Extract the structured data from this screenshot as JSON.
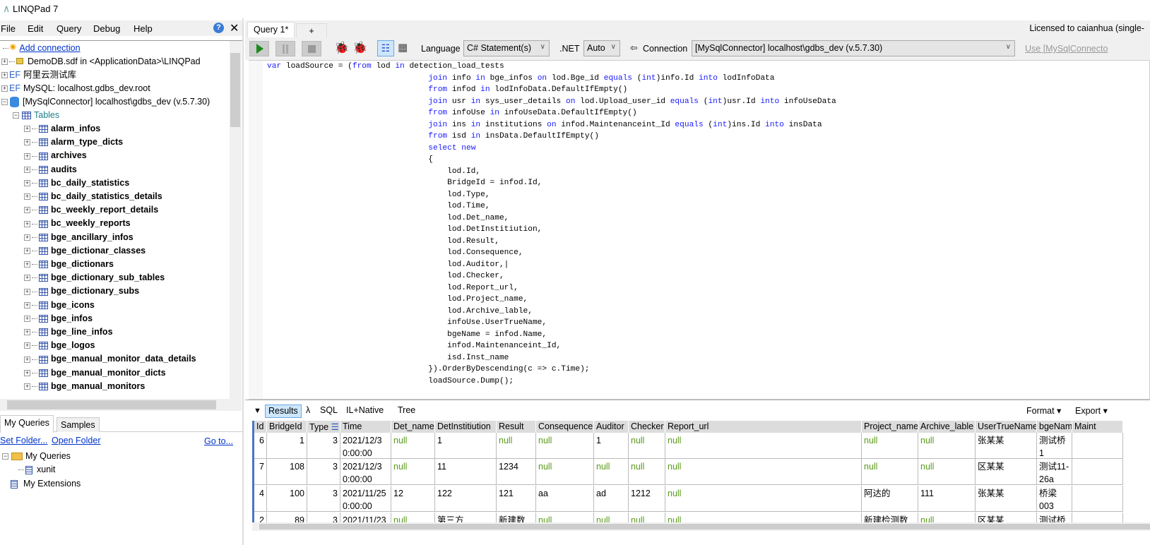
{
  "app": {
    "title": "LINQPad 7",
    "license": "Licensed to caianhua (single-"
  },
  "menu": [
    "File",
    "Edit",
    "Query",
    "Debug",
    "Help"
  ],
  "tree": {
    "add_connection": "Add connection",
    "connections": [
      {
        "icon": "database-file-icon",
        "label": "DemoDB.sdf in <ApplicationData>\\LINQPad"
      },
      {
        "icon": "ef-icon",
        "label": "阿里云测试库"
      },
      {
        "icon": "ef-icon",
        "label": "MySQL: localhost.gdbs_dev.root"
      },
      {
        "icon": "database-icon",
        "label": "[MySqlConnector] localhost\\gdbs_dev (v.5.7.30)"
      }
    ],
    "tables_label": "Tables",
    "tables": [
      "alarm_infos",
      "alarm_type_dicts",
      "archives",
      "audits",
      "bc_daily_statistics",
      "bc_daily_statistics_details",
      "bc_weekly_report_details",
      "bc_weekly_reports",
      "bge_ancillary_infos",
      "bge_dictionar_classes",
      "bge_dictionars",
      "bge_dictionary_sub_tables",
      "bge_dictionary_subs",
      "bge_icons",
      "bge_infos",
      "bge_line_infos",
      "bge_logos",
      "bge_manual_monitor_data_details",
      "bge_manual_monitor_dicts",
      "bge_manual_monitors"
    ]
  },
  "left_tabs": [
    "My Queries",
    "Samples"
  ],
  "queries": {
    "set_folder": "Set Folder...",
    "open_folder": "Open Folder",
    "go_to": "Go to...",
    "folder": "My Queries",
    "item": "xunit",
    "extensions": "My Extensions"
  },
  "query_tabs": [
    "Query 1*",
    "+"
  ],
  "toolbar": {
    "language_label": "Language",
    "language": "C# Statement(s)",
    "net_label": ".NET",
    "net": "Auto",
    "connection_label": "Connection",
    "connection": "[MySqlConnector] localhost\\gdbs_dev (v.5.7.30)",
    "use_link": "Use [MySqlConnecto"
  },
  "code": [
    [
      [
        "var",
        "k"
      ],
      [
        " loadSource = (",
        ""
      ],
      [
        "from",
        "k"
      ],
      [
        " lod ",
        ""
      ],
      [
        "in",
        "k"
      ],
      [
        " detection_load_tests",
        ""
      ]
    ],
    [
      [
        "                                  ",
        ""
      ],
      [
        "join",
        "k"
      ],
      [
        " info ",
        ""
      ],
      [
        "in",
        "k"
      ],
      [
        " bge_infos ",
        ""
      ],
      [
        "on",
        "k"
      ],
      [
        " lod.Bge_id ",
        ""
      ],
      [
        "equals",
        "k"
      ],
      [
        " (",
        ""
      ],
      [
        "int",
        "k"
      ],
      [
        ")info.Id ",
        ""
      ],
      [
        "into",
        "k"
      ],
      [
        " lodInfoData",
        ""
      ]
    ],
    [
      [
        "                                  ",
        ""
      ],
      [
        "from",
        "k"
      ],
      [
        " infod ",
        ""
      ],
      [
        "in",
        "k"
      ],
      [
        " lodInfoData.DefaultIfEmpty()",
        ""
      ]
    ],
    [
      [
        "                                  ",
        ""
      ],
      [
        "join",
        "k"
      ],
      [
        " usr ",
        ""
      ],
      [
        "in",
        "k"
      ],
      [
        " sys_user_details ",
        ""
      ],
      [
        "on",
        "k"
      ],
      [
        " lod.Upload_user_id ",
        ""
      ],
      [
        "equals",
        "k"
      ],
      [
        " (",
        ""
      ],
      [
        "int",
        "k"
      ],
      [
        ")usr.Id ",
        ""
      ],
      [
        "into",
        "k"
      ],
      [
        " infoUseData",
        ""
      ]
    ],
    [
      [
        "                                  ",
        ""
      ],
      [
        "from",
        "k"
      ],
      [
        " infoUse ",
        ""
      ],
      [
        "in",
        "k"
      ],
      [
        " infoUseData.DefaultIfEmpty()",
        ""
      ]
    ],
    [
      [
        "                                  ",
        ""
      ],
      [
        "join",
        "k"
      ],
      [
        " ins ",
        ""
      ],
      [
        "in",
        "k"
      ],
      [
        " institutions ",
        ""
      ],
      [
        "on",
        "k"
      ],
      [
        " infod.Maintenanceint_Id ",
        ""
      ],
      [
        "equals",
        "k"
      ],
      [
        " (",
        ""
      ],
      [
        "int",
        "k"
      ],
      [
        ")ins.Id ",
        ""
      ],
      [
        "into",
        "k"
      ],
      [
        " insData",
        ""
      ]
    ],
    [
      [
        "                                  ",
        ""
      ],
      [
        "from",
        "k"
      ],
      [
        " isd ",
        ""
      ],
      [
        "in",
        "k"
      ],
      [
        " insData.DefaultIfEmpty()",
        ""
      ]
    ],
    [
      [
        "                                  ",
        ""
      ],
      [
        "select",
        "k"
      ],
      [
        " ",
        ""
      ],
      [
        "new",
        "k"
      ]
    ],
    [
      [
        "                                  {",
        ""
      ]
    ],
    [
      [
        "                                      lod.Id,",
        ""
      ]
    ],
    [
      [
        "                                      BridgeId = infod.Id,",
        ""
      ]
    ],
    [
      [
        "                                      lod.Type,",
        ""
      ]
    ],
    [
      [
        "                                      lod.Time,",
        ""
      ]
    ],
    [
      [
        "                                      lod.Det_name,",
        ""
      ]
    ],
    [
      [
        "                                      lod.DetInstitiution,",
        ""
      ]
    ],
    [
      [
        "                                      lod.Result,",
        ""
      ]
    ],
    [
      [
        "                                      lod.Consequence,",
        ""
      ]
    ],
    [
      [
        "                                      lod.Auditor,|",
        ""
      ]
    ],
    [
      [
        "                                      lod.Checker,",
        ""
      ]
    ],
    [
      [
        "                                      lod.Report_url,",
        ""
      ]
    ],
    [
      [
        "                                      lod.Project_name,",
        ""
      ]
    ],
    [
      [
        "                                      lod.Archive_lable,",
        ""
      ]
    ],
    [
      [
        "                                      infoUse.UserTrueName,",
        ""
      ]
    ],
    [
      [
        "                                      bgeName = infod.Name,",
        ""
      ]
    ],
    [
      [
        "                                      infod.Maintenanceint_Id,",
        ""
      ]
    ],
    [
      [
        "                                      isd.Inst_name",
        ""
      ]
    ],
    [
      [
        "                                  }).OrderByDescending(c => c.Time);",
        ""
      ]
    ],
    [
      [
        "                                  loadSource.Dump();",
        ""
      ]
    ]
  ],
  "result_tabs": [
    "Results",
    "λ",
    "SQL",
    "IL+Native",
    "Tree"
  ],
  "result_actions": {
    "format": "Format ▾",
    "export": "Export ▾"
  },
  "grid": {
    "columns": [
      "Id",
      "BridgeId",
      "Type",
      "Time",
      "Det_name",
      "DetInstitiution",
      "Result",
      "Consequence",
      "Auditor",
      "Checker",
      "Report_url",
      "Project_name",
      "Archive_lable",
      "UserTrueName",
      "bgeName",
      "Maint"
    ],
    "rows": [
      [
        "6",
        "1",
        "3",
        "2021/12/3\n0:00:00",
        "null",
        "1",
        "null",
        "null",
        "1",
        "null",
        "null",
        "null",
        "null",
        "张某某",
        "测试桥1",
        ""
      ],
      [
        "7",
        "108",
        "3",
        "2021/12/3\n0:00:00",
        "null",
        "11",
        "1234",
        "null",
        "null",
        "null",
        "null",
        "null",
        "null",
        "区某某",
        "测试11-\n26a",
        ""
      ],
      [
        "4",
        "100",
        "3",
        "2021/11/25\n0:00:00",
        "12",
        "122",
        "121",
        "aa",
        "ad",
        "1212",
        "null",
        "阿达的",
        "111",
        "张某某",
        "桥梁003",
        ""
      ],
      [
        "2",
        "89",
        "3",
        "2021/11/23",
        "null",
        "第三方",
        "新建数",
        "null",
        "null",
        "null",
        "null",
        "新建检测数",
        "null",
        "区某某",
        "测试桥梁",
        ""
      ]
    ]
  }
}
